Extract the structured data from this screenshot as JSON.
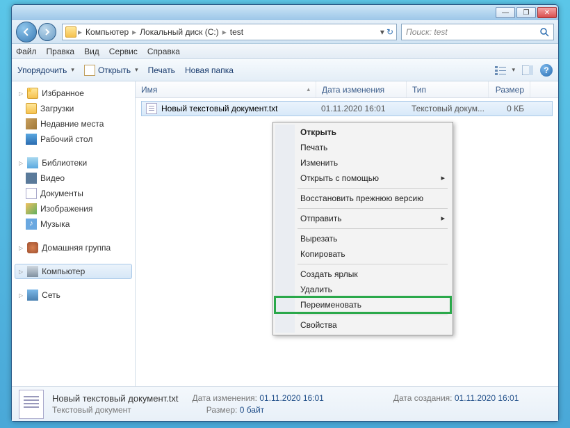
{
  "titlebar": {
    "min": "—",
    "max": "❐",
    "close": "✕"
  },
  "address": {
    "segments": [
      "Компьютер",
      "Локальный диск (C:)",
      "test"
    ]
  },
  "search": {
    "placeholder": "Поиск: test"
  },
  "menu": [
    "Файл",
    "Правка",
    "Вид",
    "Сервис",
    "Справка"
  ],
  "toolbar": {
    "organize": "Упорядочить",
    "open": "Открыть",
    "print": "Печать",
    "newfolder": "Новая папка"
  },
  "tree": {
    "favorites": {
      "head": "Избранное",
      "items": [
        "Загрузки",
        "Недавние места",
        "Рабочий стол"
      ]
    },
    "libraries": {
      "head": "Библиотеки",
      "items": [
        "Видео",
        "Документы",
        "Изображения",
        "Музыка"
      ]
    },
    "homegroup": "Домашняя группа",
    "computer": "Компьютер",
    "network": "Сеть"
  },
  "columns": {
    "name": "Имя",
    "date": "Дата изменения",
    "type": "Тип",
    "size": "Размер"
  },
  "file": {
    "name": "Новый текстовый документ.txt",
    "date": "01.11.2020 16:01",
    "type": "Текстовый докум...",
    "size": "0 КБ"
  },
  "context": {
    "open": "Открыть",
    "print": "Печать",
    "edit": "Изменить",
    "openwith": "Открыть с помощью",
    "restore": "Восстановить прежнюю версию",
    "sendto": "Отправить",
    "cut": "Вырезать",
    "copy": "Копировать",
    "shortcut": "Создать ярлык",
    "delete": "Удалить",
    "rename": "Переименовать",
    "properties": "Свойства"
  },
  "status": {
    "filename": "Новый текстовый документ.txt",
    "mod_label": "Дата изменения:",
    "mod_value": "01.11.2020 16:01",
    "created_label": "Дата создания:",
    "created_value": "01.11.2020 16:01",
    "type": "Текстовый документ",
    "size_label": "Размер:",
    "size_value": "0 байт"
  }
}
